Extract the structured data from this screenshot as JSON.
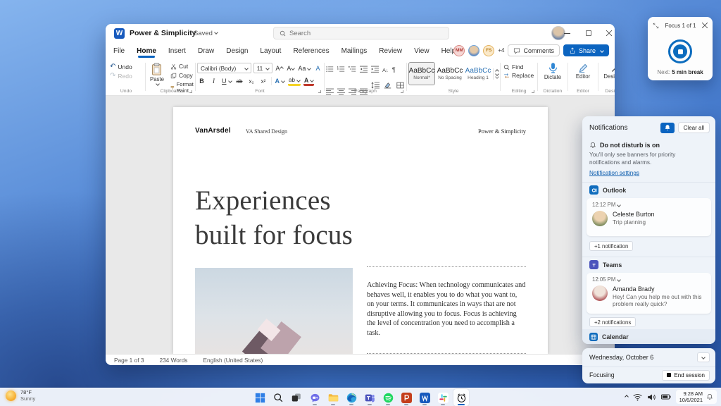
{
  "focus_widget": {
    "title": "Focus 1 of 1",
    "next_label": "Next:",
    "next_value": "5 min break"
  },
  "word": {
    "app_title": "Power & Simplicity",
    "saved_label": "Saved",
    "search_placeholder": "Search",
    "menu_tabs": [
      "File",
      "Home",
      "Insert",
      "Draw",
      "Design",
      "Layout",
      "References",
      "Mailings",
      "Review",
      "View",
      "Help"
    ],
    "collab": {
      "avatar_a": "MM",
      "avatar_c": "FS",
      "overflow": "+4",
      "comments_label": "Comments",
      "share_label": "Share"
    },
    "ribbon": {
      "undo_label": "Undo",
      "redo_label": "Redo",
      "undo_group": "Undo",
      "paste_label": "Paste",
      "cut_label": "Cut",
      "copy_label": "Copy",
      "format_paint_label": "Format Paint",
      "clipboard_group": "Clipboard",
      "font_family": "Calibri (Body)",
      "font_size": "11",
      "font_group": "Font",
      "paragraph_group": "Paragraph",
      "styles": [
        {
          "preview": "AaBbCc",
          "name": "Normal*"
        },
        {
          "preview": "AaBbCc",
          "name": "No Spacing"
        },
        {
          "preview": "AaBbCc",
          "name": "Heading 1"
        }
      ],
      "style_group": "Style",
      "find_label": "Find",
      "replace_label": "Replace",
      "editing_group": "Editing",
      "dictate_label": "Dictate",
      "dictation_group": "Dictation",
      "editor_label": "Editor",
      "editor_group": "Editor",
      "designer_label": "Designer",
      "designer_group": "Designer"
    },
    "glyphs": {
      "undo": "↶",
      "redo": "↷",
      "bold": "B",
      "italic": "I",
      "underline": "U",
      "strike": "ab",
      "sub": "x₂",
      "sup": "x²",
      "effects": "A",
      "highlight": "ab",
      "color": "A",
      "case": "Aa",
      "grow": "A",
      "shrink": "A",
      "pilcrow": "¶",
      "sort": "A↓"
    },
    "document": {
      "logo": "VanArsdel",
      "header_center": "VA Shared Design",
      "header_right": "Power & Simplicity",
      "heading_line1": "Experiences",
      "heading_line2": "built for focus",
      "body": "Achieving Focus: When technology communicates and behaves well, it enables you to do what you want to, on your terms. It communicates in ways that are not disruptive allowing you to focus. Focus is achieving the level of concentration you need to accomplish a task."
    },
    "status": {
      "page": "Page 1 of 3",
      "words": "234 Words",
      "language": "English (United States)"
    }
  },
  "notifications": {
    "title": "Notifications",
    "clear_all": "Clear all",
    "dnd_title": "Do not disturb is on",
    "dnd_description": "You'll only see banners for priority notifications and alarms.",
    "settings_link": "Notification settings",
    "outlook": {
      "app": "Outlook",
      "time": "12:12 PM",
      "sender": "Celeste Burton",
      "subject": "Trip planning",
      "more": "+1 notification"
    },
    "teams": {
      "app": "Teams",
      "time": "12:05 PM",
      "sender": "Amanda Brady",
      "message": "Hey! Can you help me out with this problem really quick?",
      "more": "+2 notifications"
    },
    "calendar_label": "Calendar"
  },
  "calendar_card": {
    "date": "Wednesday, October 6",
    "focusing_label": "Focusing",
    "end_session_label": "End session"
  },
  "taskbar": {
    "weather_temp": "78°F",
    "weather_condition": "Sunny",
    "icons": [
      "start",
      "search",
      "task-view",
      "chat",
      "file-explorer",
      "edge",
      "teams",
      "spotify",
      "powerpoint",
      "word",
      "slack",
      "clock"
    ],
    "tray_time": "9:28 AM",
    "tray_date": "10/6/2021"
  },
  "colors": {
    "accent": "#0b64c0",
    "word_blue": "#185abd",
    "spotify_green": "#1ed760"
  }
}
